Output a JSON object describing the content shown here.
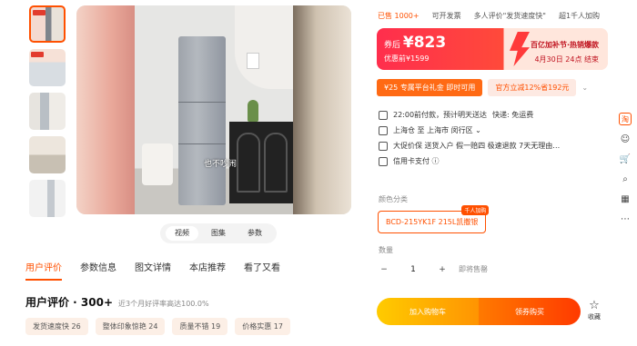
{
  "gallery": {
    "caption": "也不吵闹",
    "tabs": [
      "视频",
      "图集",
      "参数"
    ]
  },
  "product_tabs": [
    "用户评价",
    "参数信息",
    "图文详情",
    "本店推荐",
    "看了又看"
  ],
  "reviews": {
    "title": "用户评价 · 300+",
    "subtitle": "近3个月好评率高达100.0%",
    "chips": [
      "发货速度快 26",
      "整体印象惊艳 24",
      "质量不错 19",
      "价格实惠 17"
    ]
  },
  "stats": [
    "已售 1000+",
    "可开发票",
    "多人评价\"发货速度快\"",
    "超1千人加购"
  ],
  "promo": {
    "label": "券后",
    "price": "¥823",
    "original": "优惠前¥1599",
    "event": "百亿加补节·热销爆款",
    "date": "4月30日 24点 结束"
  },
  "coupons": {
    "platform": "¥25 专属平台礼金 即时可用",
    "official": "官方立减12%省192元",
    "dropdown": "⌄"
  },
  "info": {
    "delivery": "22:00前付款，预计明天送达",
    "shipping": "快递: 免运费",
    "route": "上海仓 至 上海市 闵行区 ⌄",
    "services": "大促价保 送货入户 假一赔四 极速退款 7天无理由…",
    "payment": "信用卡支付 ⓘ"
  },
  "color_label": "颜色分类",
  "color_option": "BCD-215YK1F 215L凯撒银",
  "color_tag": "千人加购",
  "quantity": {
    "label": "数量",
    "minus": "−",
    "value": "1",
    "plus": "+",
    "note": "即将售罄"
  },
  "buttons": {
    "cart": "加入购物车",
    "buy": "领券购买",
    "fav": "收藏"
  },
  "side": [
    "淘",
    "☺",
    "🛒",
    "⌕",
    "▦",
    "⋯"
  ]
}
